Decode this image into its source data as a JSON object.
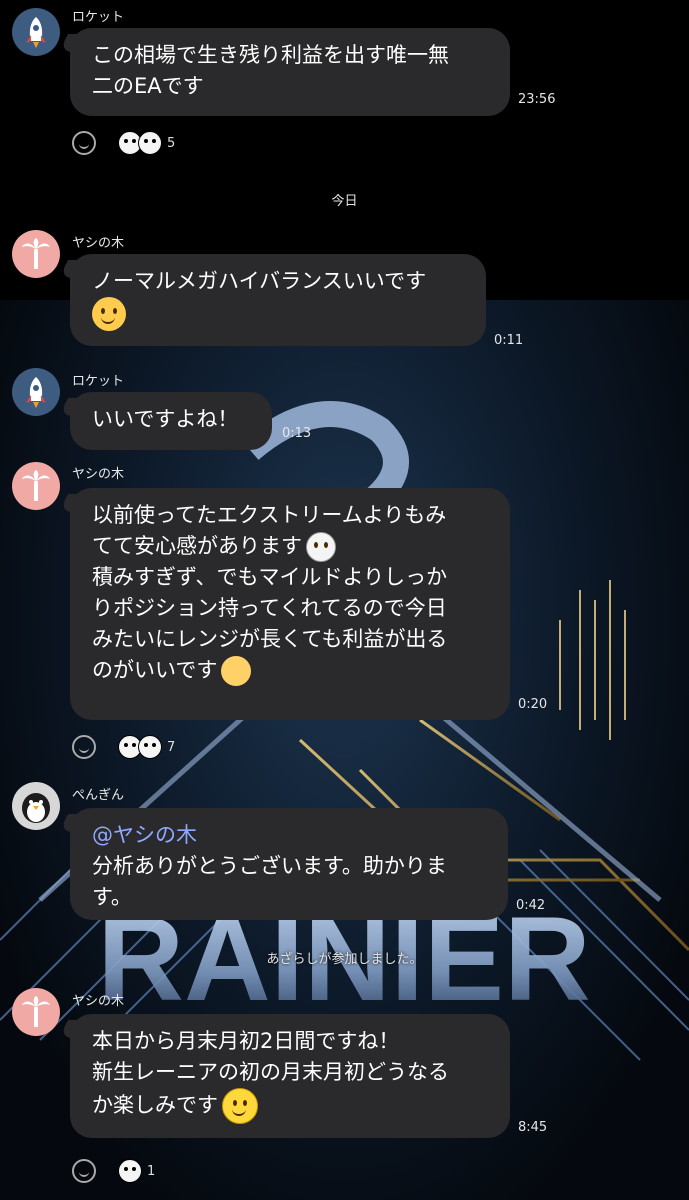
{
  "date_divider": "今日",
  "system_message": "あざらしが参加しました。",
  "messages": [
    {
      "sender": "ロケット",
      "text_lines": [
        "この相場で生き残り利益を出す唯一無",
        "二のEAです"
      ],
      "time": "23:56",
      "reaction_count": "5"
    },
    {
      "sender": "ヤシの木",
      "text_lines": [
        "ノーマルメガハイバランスいいです"
      ],
      "time": "0:11"
    },
    {
      "sender": "ロケット",
      "text_lines": [
        "いいですよね！"
      ],
      "time": "0:13"
    },
    {
      "sender": "ヤシの木",
      "text_lines": [
        "以前使ってたエクストリームよりもみ",
        "てて安心感があります",
        "積みすぎず、でもマイルドよりしっか",
        "りポジション持ってくれてるので今日",
        "みたいにレンジが長くても利益が出る",
        "のがいいです"
      ],
      "time": "0:20",
      "reaction_count": "7"
    },
    {
      "sender": "ぺんぎん",
      "mention": "@ヤシの木",
      "text_lines": [
        "分析ありがとうございます。助かりま",
        "す。"
      ],
      "time": "0:42"
    },
    {
      "sender": "ヤシの木",
      "text_lines": [
        "本日から月末月初2日間ですね！",
        "新生レーニアの初の月末月初どうなる",
        "か楽しみです"
      ],
      "time": "8:45",
      "reaction_count": "1"
    }
  ],
  "wallpaper_text": "RAINIER",
  "colors": {
    "bubble": "#2a2a2c",
    "mention": "#8ea9ff",
    "background": "#000000"
  }
}
